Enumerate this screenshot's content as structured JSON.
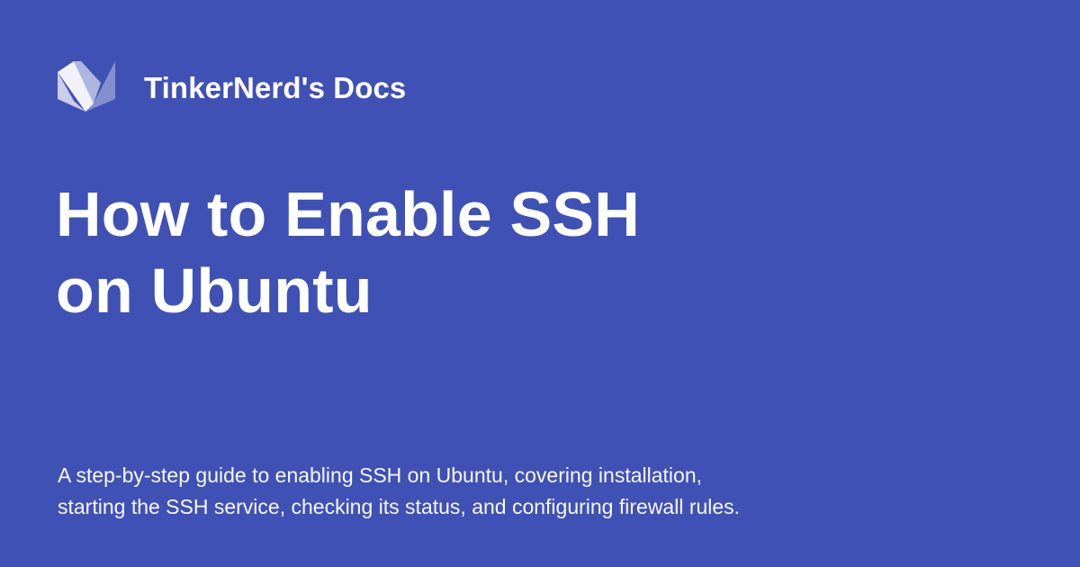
{
  "header": {
    "site_name": "TinkerNerd's Docs",
    "logo_icon": "docs-logo-icon"
  },
  "article": {
    "title_line_1": "How to Enable SSH",
    "title_line_2": "on Ubuntu",
    "description_line_1": "A step-by-step guide to enabling SSH on Ubuntu, covering installation,",
    "description_line_2": "starting the SSH service, checking its status, and configuring firewall rules."
  },
  "colors": {
    "background": "#3f51b5",
    "text": "#ffffff"
  }
}
